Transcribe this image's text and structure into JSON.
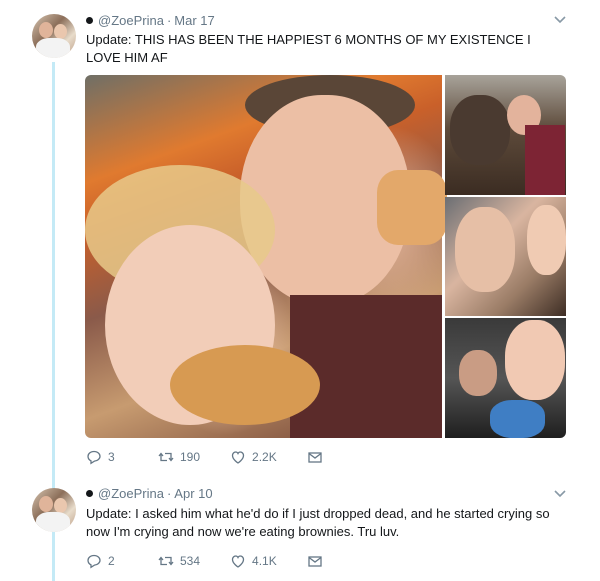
{
  "tweets": [
    {
      "handle": "@ZoePrina",
      "separator": "·",
      "date": "Mar 17",
      "text": "Update: THIS HAS BEEN THE HAPPIEST 6 MONTHS OF MY EXISTENCE I LOVE HIM AF",
      "replies": "3",
      "retweets": "190",
      "likes": "2.2K"
    },
    {
      "handle": "@ZoePrina",
      "separator": "·",
      "date": "Apr 10",
      "text": "Update: I asked him what he'd do if I just dropped dead, and he started crying so now I'm crying and now we're eating brownies. Tru luv.",
      "replies": "2",
      "retweets": "534",
      "likes": "4.1K"
    }
  ],
  "icons": {
    "reply": "reply-icon",
    "retweet": "retweet-icon",
    "like": "heart-icon",
    "dm": "envelope-icon",
    "menu": "chevron-down-icon",
    "badge": "dot-icon"
  },
  "colors": {
    "thread_line": "#c4eaf6",
    "meta": "#657786",
    "text": "#14171a"
  }
}
